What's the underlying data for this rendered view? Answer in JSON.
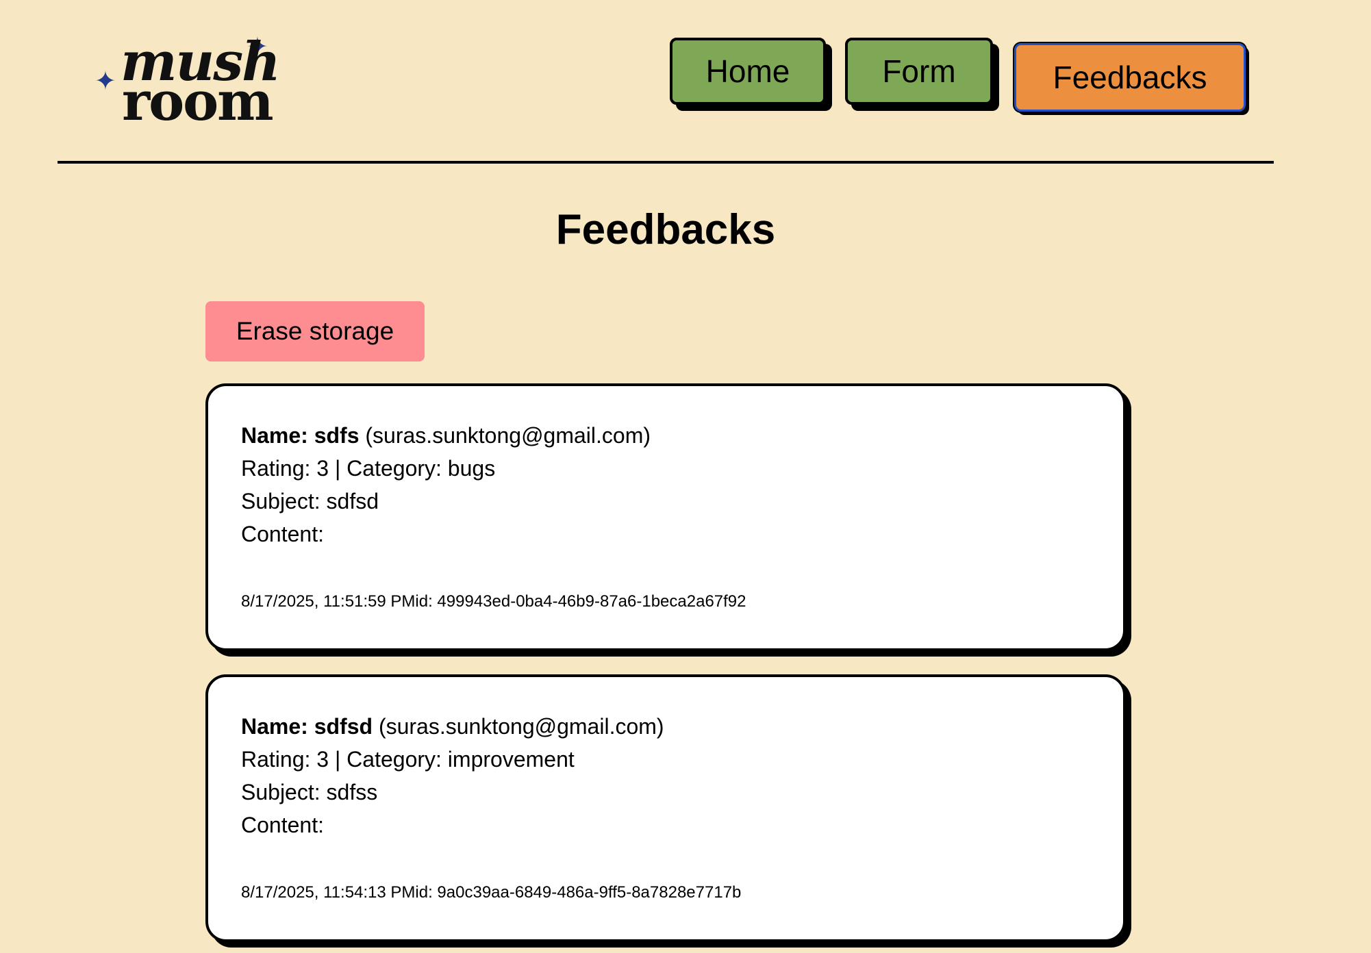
{
  "logo": {
    "line1": "mush",
    "line2": "room",
    "star_icon": "sparkle-star",
    "star_color": "#233a8a"
  },
  "nav": {
    "home_label": "Home",
    "form_label": "Form",
    "feedbacks_label": "Feedbacks",
    "inactive_color": "#7ea756",
    "active_color": "#ec9040"
  },
  "page": {
    "title": "Feedbacks",
    "background": "#f7e7c2"
  },
  "actions": {
    "erase_label": "Erase storage",
    "erase_color": "#fd8d90"
  },
  "feedbacks": [
    {
      "name_label": "Name:",
      "name": "sdfs",
      "email": "(suras.sunktong@gmail.com)",
      "rating_line": "Rating: 3 | Category: bugs",
      "subject_line": "Subject: sdfsd",
      "content_line": "Content:",
      "meta": "8/17/2025, 11:51:59 PMid: 499943ed-0ba4-46b9-87a6-1beca2a67f92"
    },
    {
      "name_label": "Name:",
      "name": "sdfsd",
      "email": "(suras.sunktong@gmail.com)",
      "rating_line": "Rating: 3 | Category: improvement",
      "subject_line": "Subject: sdfss",
      "content_line": "Content:",
      "meta": "8/17/2025, 11:54:13 PMid: 9a0c39aa-6849-486a-9ff5-8a7828e7717b"
    }
  ]
}
